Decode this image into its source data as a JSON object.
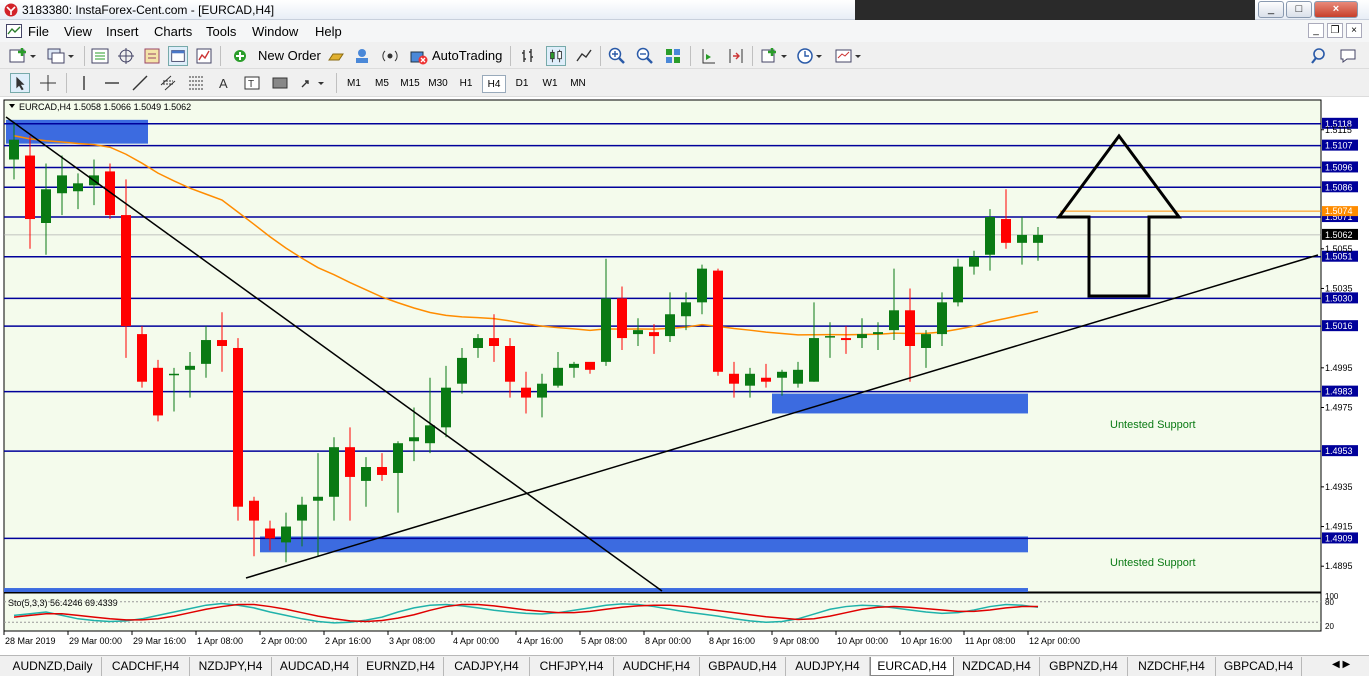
{
  "window": {
    "title": "3183380: InstaForex-Cent.com - [EURCAD,H4]",
    "controls": [
      "_",
      "□",
      "×"
    ],
    "mdi_controls": [
      "_",
      "❐",
      "×"
    ]
  },
  "menu": [
    "File",
    "View",
    "Insert",
    "Charts",
    "Tools",
    "Window",
    "Help"
  ],
  "toolbar": {
    "new_order": "New Order",
    "auto_trading": "AutoTrading"
  },
  "timeframes": [
    "M1",
    "M5",
    "M15",
    "M30",
    "H1",
    "H4",
    "D1",
    "W1",
    "MN"
  ],
  "active_timeframe": "H4",
  "chart": {
    "info": "EURCAD,H4  1.5058 1.5066 1.5049 1.5062",
    "indicator_label": "Sto(5,3,3) 56.4246 69.4339",
    "annotations": [
      "Untested Support",
      "Untested Support"
    ],
    "bull_color": "#0a7a14",
    "bear_color": "#ff0000",
    "level_color": "#00009a",
    "zone_color": "#3c6be0"
  },
  "chart_data": {
    "type": "candlestick",
    "symbol": "EURCAD",
    "timeframe": "H4",
    "ylim": [
      1.4882,
      1.513
    ],
    "price_levels": [
      "1.5118",
      "1.5107",
      "1.5096",
      "1.5086",
      "1.5071",
      "1.5051",
      "1.5030",
      "1.5016",
      "1.4983",
      "1.4953",
      "1.4909"
    ],
    "ma_label": "1.5074",
    "current_price": "1.5062",
    "y_ticks": [
      "1.5115",
      "1.5055",
      "1.5035",
      "1.4995",
      "1.4975",
      "1.4935",
      "1.4915",
      "1.4895"
    ],
    "x_ticks": [
      "28 Mar 2019",
      "29 Mar 00:00",
      "29 Mar 16:00",
      "1 Apr 08:00",
      "2 Apr 00:00",
      "2 Apr 16:00",
      "3 Apr 08:00",
      "4 Apr 00:00",
      "4 Apr 16:00",
      "5 Apr 08:00",
      "8 Apr 00:00",
      "8 Apr 16:00",
      "9 Apr 08:00",
      "10 Apr 00:00",
      "10 Apr 16:00",
      "11 Apr 08:00",
      "12 Apr 00:00"
    ],
    "stoch_ticks": [
      "100",
      "80",
      "20"
    ],
    "candles": [
      [
        1.51,
        1.5118,
        1.509,
        1.511
      ],
      [
        1.5102,
        1.5112,
        1.5055,
        1.507
      ],
      [
        1.5068,
        1.5098,
        1.5052,
        1.5085
      ],
      [
        1.5083,
        1.5102,
        1.5072,
        1.5092
      ],
      [
        1.5084,
        1.5093,
        1.5075,
        1.5088
      ],
      [
        1.5087,
        1.51,
        1.5077,
        1.5092
      ],
      [
        1.5094,
        1.5098,
        1.507,
        1.5072
      ],
      [
        1.5072,
        1.509,
        1.5,
        1.5016
      ],
      [
        1.5012,
        1.5016,
        1.4985,
        1.4988
      ],
      [
        1.4995,
        1.4999,
        1.4968,
        1.4971
      ],
      [
        1.4992,
        1.4995,
        1.4973,
        1.4992
      ],
      [
        1.4994,
        1.5003,
        1.498,
        1.4996
      ],
      [
        1.4997,
        1.5016,
        1.499,
        1.5009
      ],
      [
        1.5009,
        1.5023,
        1.4993,
        1.5006
      ],
      [
        1.5005,
        1.501,
        1.4918,
        1.4925
      ],
      [
        1.4928,
        1.493,
        1.49,
        1.4918
      ],
      [
        1.4914,
        1.4918,
        1.4903,
        1.4909
      ],
      [
        1.4907,
        1.4922,
        1.4897,
        1.4915
      ],
      [
        1.4918,
        1.493,
        1.4905,
        1.4926
      ],
      [
        1.4928,
        1.4952,
        1.49,
        1.493
      ],
      [
        1.493,
        1.496,
        1.4918,
        1.4955
      ],
      [
        1.4955,
        1.4965,
        1.4918,
        1.494
      ],
      [
        1.4938,
        1.495,
        1.4925,
        1.4945
      ],
      [
        1.4945,
        1.4952,
        1.4938,
        1.4941
      ],
      [
        1.4942,
        1.4958,
        1.4922,
        1.4957
      ],
      [
        1.4958,
        1.4975,
        1.4948,
        1.496
      ],
      [
        1.4957,
        1.499,
        1.4952,
        1.4966
      ],
      [
        1.4965,
        1.4996,
        1.496,
        1.4985
      ],
      [
        1.4987,
        1.5005,
        1.4982,
        1.5
      ],
      [
        1.5005,
        1.5012,
        1.5,
        1.501
      ],
      [
        1.501,
        1.5022,
        1.4998,
        1.5006
      ],
      [
        1.5006,
        1.501,
        1.498,
        1.4988
      ],
      [
        1.4985,
        1.4993,
        1.4972,
        1.498
      ],
      [
        1.498,
        1.4992,
        1.497,
        1.4987
      ],
      [
        1.4986,
        1.5003,
        1.4985,
        1.4995
      ],
      [
        1.4995,
        1.4998,
        1.499,
        1.4997
      ],
      [
        1.4998,
        1.4996,
        1.4992,
        1.4994
      ],
      [
        1.4998,
        1.505,
        1.4996,
        1.503
      ],
      [
        1.503,
        1.5036,
        1.5004,
        1.501
      ],
      [
        1.5012,
        1.502,
        1.5006,
        1.5014
      ],
      [
        1.5013,
        1.5017,
        1.5002,
        1.5011
      ],
      [
        1.5011,
        1.5033,
        1.5008,
        1.5022
      ],
      [
        1.5021,
        1.5033,
        1.5014,
        1.5028
      ],
      [
        1.5028,
        1.5047,
        1.5022,
        1.5045
      ],
      [
        1.5044,
        1.5045,
        1.4991,
        1.4993
      ],
      [
        1.4992,
        1.4998,
        1.498,
        1.4987
      ],
      [
        1.4986,
        1.4995,
        1.498,
        1.4992
      ],
      [
        1.499,
        1.4997,
        1.4985,
        1.4988
      ],
      [
        1.499,
        1.4994,
        1.4981,
        1.4993
      ],
      [
        1.4987,
        1.4998,
        1.4985,
        1.4994
      ],
      [
        1.4988,
        1.5028,
        1.4988,
        1.501
      ],
      [
        1.5011,
        1.5018,
        1.5,
        1.5011
      ],
      [
        1.501,
        1.5016,
        1.5002,
        1.5009
      ],
      [
        1.501,
        1.502,
        1.5005,
        1.5012
      ],
      [
        1.5012,
        1.5018,
        1.5004,
        1.5013
      ],
      [
        1.5014,
        1.5045,
        1.5009,
        1.5024
      ],
      [
        1.5024,
        1.5035,
        1.4988,
        1.5006
      ],
      [
        1.5005,
        1.5014,
        1.4995,
        1.5012
      ],
      [
        1.5012,
        1.5033,
        1.5006,
        1.5028
      ],
      [
        1.5028,
        1.505,
        1.5026,
        1.5046
      ],
      [
        1.5046,
        1.5054,
        1.5042,
        1.5051
      ],
      [
        1.5052,
        1.5075,
        1.5044,
        1.5071
      ],
      [
        1.507,
        1.5085,
        1.5055,
        1.5058
      ],
      [
        1.5058,
        1.5071,
        1.5047,
        1.5062
      ],
      [
        1.5058,
        1.5066,
        1.5049,
        1.5062
      ]
    ],
    "stochastic": {
      "k": [
        40,
        45,
        50,
        40,
        30,
        25,
        22,
        24,
        30,
        40,
        50,
        60,
        70,
        75,
        70,
        62,
        50,
        40,
        30,
        22,
        18,
        20,
        26,
        35,
        50,
        62,
        70,
        72,
        68,
        62,
        55,
        50,
        46,
        44,
        48,
        55,
        62,
        70,
        74,
        72,
        66,
        58,
        50,
        44,
        38,
        30,
        24,
        20,
        22,
        30,
        44,
        58,
        66,
        70,
        68,
        62,
        56,
        50,
        46,
        48,
        56,
        66,
        72,
        70,
        64
      ],
      "d": [
        35,
        40,
        45,
        45,
        40,
        35,
        30,
        27,
        27,
        30,
        38,
        48,
        58,
        66,
        72,
        72,
        66,
        58,
        48,
        38,
        30,
        24,
        22,
        25,
        32,
        42,
        55,
        66,
        72,
        72,
        68,
        62,
        56,
        52,
        48,
        48,
        52,
        58,
        64,
        68,
        70,
        70,
        66,
        60,
        54,
        48,
        42,
        36,
        32,
        28,
        30,
        38,
        48,
        58,
        64,
        66,
        64,
        60,
        56,
        52,
        52,
        56,
        62,
        66,
        66
      ]
    }
  },
  "symbol_tabs": [
    "AUDNZD,Daily",
    "CADCHF,H4",
    "NZDJPY,H4",
    "AUDCAD,H4",
    "EURNZD,H4",
    "CADJPY,H4",
    "CHFJPY,H4",
    "AUDCHF,H4",
    "GBPAUD,H4",
    "AUDJPY,H4",
    "EURCAD,H4",
    "NZDCAD,H4",
    "GBPNZD,H4",
    "NZDCHF,H4",
    "GBPCAD,H4"
  ],
  "active_tab": "EURCAD,H4"
}
